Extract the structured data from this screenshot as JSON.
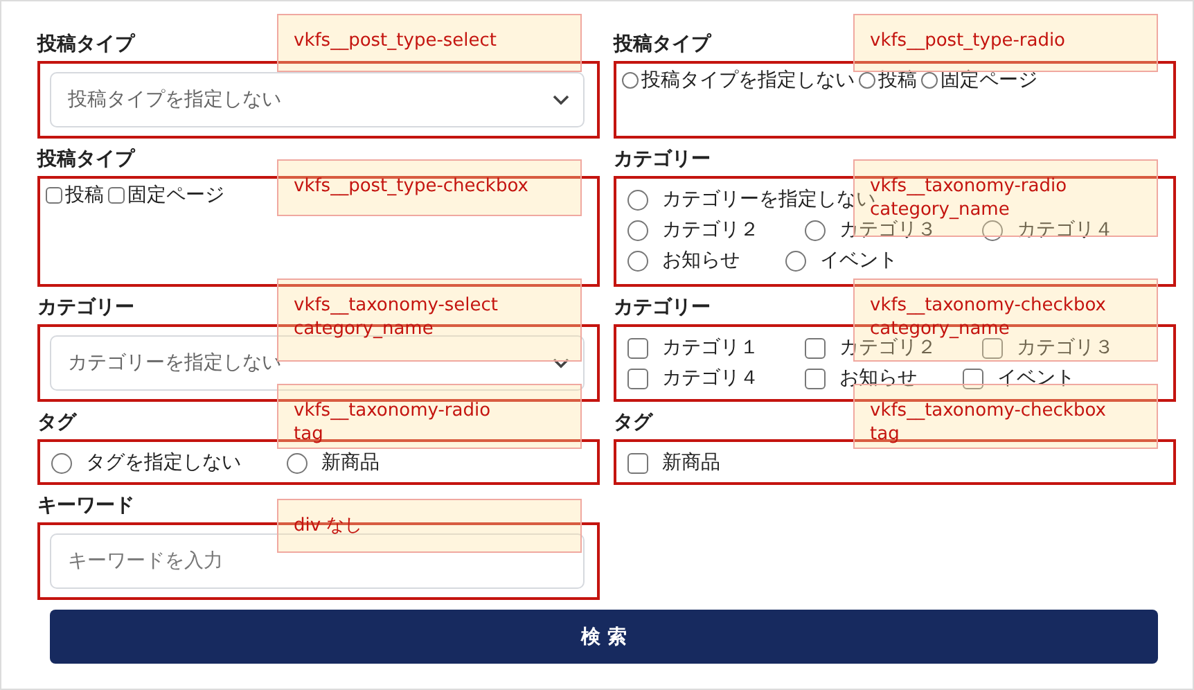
{
  "rows": [
    {
      "left": {
        "label": "投稿タイプ",
        "kind": "select",
        "placeholder": "投稿タイプを指定しない",
        "note": [
          "vkfs__post_type-select"
        ]
      },
      "right": {
        "label": "投稿タイプ",
        "kind": "radio_plain",
        "options": [
          {
            "label": "投稿タイプを指定しない",
            "selected": false
          },
          {
            "label": "投稿",
            "selected": false
          },
          {
            "label": "固定ページ",
            "selected": false
          }
        ],
        "note": [
          "vkfs__post_type-radio"
        ]
      }
    },
    {
      "left": {
        "label": "投稿タイプ",
        "kind": "checkbox_plain",
        "options": [
          {
            "label": "投稿",
            "checked": false
          },
          {
            "label": "固定ページ",
            "checked": false
          }
        ],
        "note": [
          "vkfs__post_type-checkbox"
        ]
      },
      "right": {
        "label": "カテゴリー",
        "kind": "radio",
        "options": [
          {
            "label": "カテゴリーを指定しない",
            "selected": false
          },
          {
            "label": "カテゴリ２",
            "selected": false
          },
          {
            "label": "カテゴリ３",
            "selected": false
          },
          {
            "label": "カテゴリ４",
            "selected": false
          },
          {
            "label": "お知らせ",
            "selected": false
          },
          {
            "label": "イベント",
            "selected": false
          }
        ],
        "note": [
          "vkfs__taxonomy-radio",
          "category_name"
        ]
      }
    },
    {
      "left": {
        "label": "カテゴリー",
        "kind": "select",
        "placeholder": "カテゴリーを指定しない",
        "note": [
          "vkfs__taxonomy-select",
          "category_name"
        ]
      },
      "right": {
        "label": "カテゴリー",
        "kind": "checkbox",
        "options": [
          {
            "label": "カテゴリ１",
            "checked": false
          },
          {
            "label": "カテゴリ２",
            "checked": false
          },
          {
            "label": "カテゴリ３",
            "checked": false
          },
          {
            "label": "カテゴリ４",
            "checked": false
          },
          {
            "label": "お知らせ",
            "checked": false
          },
          {
            "label": "イベント",
            "checked": false
          }
        ],
        "note": [
          "vkfs__taxonomy-checkbox",
          "category_name"
        ]
      }
    },
    {
      "left": {
        "label": "タグ",
        "kind": "radio",
        "options": [
          {
            "label": "タグを指定しない",
            "selected": false
          },
          {
            "label": "新商品",
            "selected": false
          }
        ],
        "note": [
          "vkfs__taxonomy-radio",
          "tag"
        ]
      },
      "right": {
        "label": "タグ",
        "kind": "checkbox",
        "options": [
          {
            "label": "新商品",
            "checked": false
          }
        ],
        "note": [
          "vkfs__taxonomy-checkbox",
          "tag"
        ]
      }
    },
    {
      "left": {
        "label": "キーワード",
        "kind": "text",
        "placeholder": "キーワードを入力",
        "note": [
          "div なし"
        ]
      }
    }
  ],
  "search_button": "検 索"
}
